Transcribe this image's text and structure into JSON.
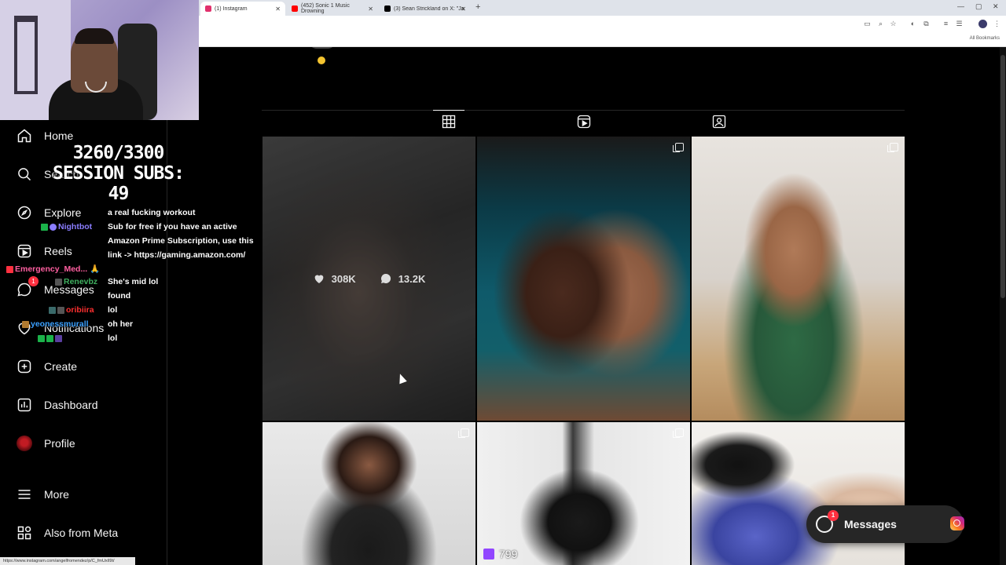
{
  "browser": {
    "tabs": [
      {
        "label": "(1) Instagram",
        "favicon_color": "#e1306c",
        "active": true
      },
      {
        "label": "(452) Sonic 1 Music Drowning",
        "favicon_color": "#ff0000",
        "active": false
      },
      {
        "label": "(3) Sean Strickland on X: \"Jacks",
        "favicon_color": "#000000",
        "active": false
      }
    ],
    "new_tab_icon": "plus-icon",
    "all_bookmarks": "All Bookmarks",
    "status_url": "https://www.instagram.com/angelfromendez/p/C_fmUxIl9t/"
  },
  "sidebar": {
    "items": [
      {
        "label": "Home",
        "icon": "home-icon"
      },
      {
        "label": "Search",
        "icon": "search-icon"
      },
      {
        "label": "Explore",
        "icon": "compass-icon"
      },
      {
        "label": "Reels",
        "icon": "reels-icon"
      },
      {
        "label": "Messages",
        "icon": "messenger-icon",
        "badge": "1"
      },
      {
        "label": "Notifications",
        "icon": "heart-icon"
      },
      {
        "label": "Create",
        "icon": "plus-square-icon"
      },
      {
        "label": "Dashboard",
        "icon": "dashboard-icon"
      },
      {
        "label": "Profile",
        "icon": "avatar"
      },
      {
        "label": "More",
        "icon": "menu-icon"
      },
      {
        "label": "Also from Meta",
        "icon": "meta-icon"
      }
    ]
  },
  "overlay": {
    "sub_goal": "3260/3300",
    "session_subs": "SESSION SUBS: 49"
  },
  "chat": {
    "messages": [
      {
        "user": "",
        "text": "a real fucking workout"
      },
      {
        "user": "Nightbot",
        "text": "Sub for free if you have an active"
      },
      {
        "user": "",
        "text": "Amazon Prime Subscription, use this"
      },
      {
        "user": "",
        "text": "link -> https://gaming.amazon.com/"
      },
      {
        "user": "Emergency_Med...",
        "text": ""
      },
      {
        "user": "Renevbz",
        "text": "She's mid lol"
      },
      {
        "user": "",
        "text": "found"
      },
      {
        "user": "oribiira",
        "text": "lol"
      },
      {
        "user": "yeonessmurall",
        "text": "oh her"
      },
      {
        "user": "",
        "text": "lol"
      }
    ],
    "colors": {
      "nightbot": "#8a7dff",
      "emergency": "#ff5fa0",
      "renevbz": "#40b060",
      "oribiira": "#ff3030",
      "yeoness": "#3aa0ff"
    }
  },
  "profile_tabs": [
    {
      "name": "posts",
      "icon": "grid-icon"
    },
    {
      "name": "reels",
      "icon": "reels-icon"
    },
    {
      "name": "tagged",
      "icon": "tagged-icon"
    }
  ],
  "posts": [
    {
      "likes": "308K",
      "comments": "13.2K",
      "hovered": true,
      "multi": true
    },
    {
      "multi": true
    },
    {
      "multi": true
    },
    {
      "multi": true
    },
    {
      "multi": true,
      "views": "799"
    },
    {
      "multi": true
    }
  ],
  "messages_float": {
    "label": "Messages",
    "badge": "1"
  }
}
